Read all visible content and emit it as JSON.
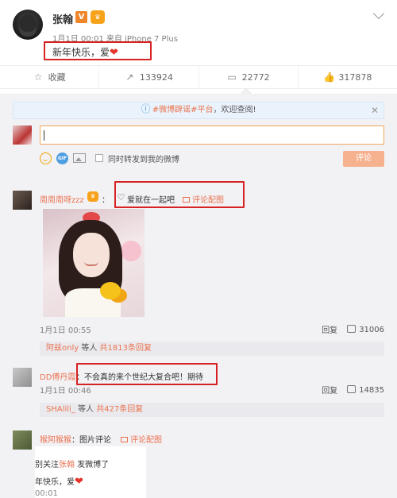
{
  "post": {
    "author": "张翰",
    "verified_badge": "V",
    "meta": "1月1日 00:01 来自 iPhone 7 Plus",
    "text": "新年快乐，爱",
    "heart": "❤"
  },
  "actions": {
    "favorite_label": "收藏",
    "repost_count": "133924",
    "comment_count": "22772",
    "like_count": "317878"
  },
  "notice": {
    "hashtag": "#微博辟谣#平台",
    "suffix": "，欢迎查阅!"
  },
  "composer": {
    "repost_label": "同时转发到我的微博",
    "submit_label": "评论"
  },
  "comments": [
    {
      "name": "周周周呀zzz",
      "colon": "：",
      "text": "爱就在一起吧",
      "pic_link": "评论配图",
      "time": "1月1日 00:55",
      "reply_label": "回复",
      "likes": "31006",
      "sub_name": "阿兹only",
      "sub_mid": " 等人 ",
      "sub_count": "共1813条回复"
    },
    {
      "name": "DD傅丹霞",
      "colon": "：",
      "text": "不会真的来个世纪大复合吧！期待",
      "time": "1月1日 00:46",
      "reply_label": "回复",
      "likes": "14835",
      "sub_name": "SHAlili_",
      "sub_mid": " 等人 ",
      "sub_count": "共427条回复"
    },
    {
      "name": "猴阿猴猴",
      "text": "：图片评论",
      "pic_link": "评论配图"
    }
  ],
  "embedded_screenshot": {
    "line1_prefix": "别关注",
    "line1_name": "张翰",
    "line1_suffix": " 发微博了",
    "line2": "年快乐，爱",
    "line3": "00:01"
  },
  "colors": {
    "accent_orange": "#eb7350",
    "highlight_red": "#d62222",
    "comment_bg": "#f2f2f5"
  }
}
